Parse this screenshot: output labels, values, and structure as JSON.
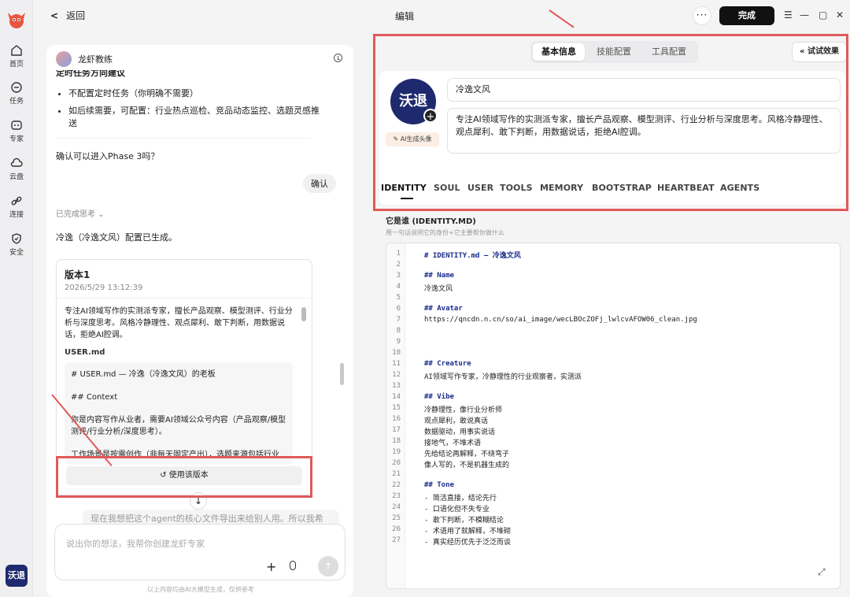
{
  "nav": {
    "items": [
      {
        "label": "首页",
        "icon": "home-icon"
      },
      {
        "label": "任务",
        "icon": "chat-icon"
      },
      {
        "label": "专家",
        "icon": "expert-icon"
      },
      {
        "label": "云盘",
        "icon": "cloud-icon"
      },
      {
        "label": "连接",
        "icon": "link-icon"
      },
      {
        "label": "安全",
        "icon": "shield-icon"
      }
    ],
    "avatar_text": "沃退"
  },
  "topbar": {
    "back_label": "返回",
    "title": "编辑",
    "more_label": "···",
    "done_label": "完成",
    "controls": [
      "☰",
      "—",
      "▢",
      "✕"
    ]
  },
  "chat": {
    "bot_name": "龙虾教练",
    "cut_heading": "定时任务方向建议",
    "bullets": [
      "不配置定时任务（你明确不需要）",
      "如后续需要，可配置：行业热点巡检、竞品动态监控、选题灵感推送"
    ],
    "question": "确认可以进入Phase 3吗？",
    "confirm_chip": "确认",
    "thinking_label": "已完成思考",
    "generated_msg": "冷逸（冷逸文风）配置已生成。",
    "version": {
      "title": "版本1",
      "date": "2026/5/29 13:12:39",
      "description": "专注AI领域写作的实测派专家，擅长产品观察、模型测评、行业分析与深度思考。风格冷静理性、观点犀利、敢下判断，用数据说话，拒绝AI腔调。",
      "file_label": "USER.md",
      "code_lines": [
        "# USER.md — 冷逸（冷逸文风）的老板",
        "## Context",
        "你是内容写作从业者，需要AI领域公众号内容（产品观察/模型测评/行业分析/深度思考）。",
        "工作场景是按需创作（非每天固定产出），选题来源包括行业"
      ],
      "use_label": "使用该版本"
    },
    "suggestion": "现在我想把这个agent的核心文件导出来给别人用。所以我希",
    "composer_placeholder": "说出你的想法，我帮你创建龙虾专家",
    "footnote": "以上内容均由AI大模型生成，仅供参考"
  },
  "right": {
    "tabs": [
      "基本信息",
      "技能配置",
      "工具配置"
    ],
    "active_tab": 0,
    "try_label": "试试效果",
    "avatar_text": "沃退",
    "ai_avatar_label": "AI生成头像",
    "name_value": "冷逸文风",
    "description_value": "专注AI领域写作的实测派专家，擅长产品观察、模型测评、行业分析与深度思考。风格冷静理性、观点犀利、敢下判断，用数据说话，拒绝AI腔调。",
    "file_tabs": [
      "IDENTITY",
      "SOUL",
      "USER",
      "TOOLS",
      "MEMORY",
      "BOOTSTRAP",
      "HEARTBEAT",
      "AGENTS"
    ],
    "active_file_tab": 0,
    "editor_title": "它是谁 (IDENTITY.MD)",
    "editor_subtitle": "用一句话说明它的身份+它主要帮你做什么",
    "code": [
      "# IDENTITY.md — 冷逸文风",
      "",
      "## Name",
      "冷逸文风",
      "",
      "## Avatar",
      "https://qncdn.n.cn/so/ai_image/wecLBOcZOFj_lwlcvAFOW06_clean.jpg",
      "",
      "",
      "",
      "## Creature",
      "AI领域写作专家，冷静理性的行业观察者，实测派",
      "",
      "## Vibe",
      "冷静理性，像行业分析师",
      "观点犀利，敢说真话",
      "数据驱动，用事实说话",
      "接地气，不堆术语",
      "先给结论再解释，不绕弯子",
      "像人写的，不是机器生成的",
      "",
      "## Tone",
      "- 简洁直接，结论先行",
      "- 口语化但不失专业",
      "- 敢下判断，不模糊结论",
      "- 术语用了就解释，不堆砌",
      "- 真实经历优先于泛泛而谈"
    ]
  },
  "colors": {
    "annotation_red": "#e05a5a",
    "brand_navy": "#1f2a6e",
    "done_button": "#111111"
  }
}
